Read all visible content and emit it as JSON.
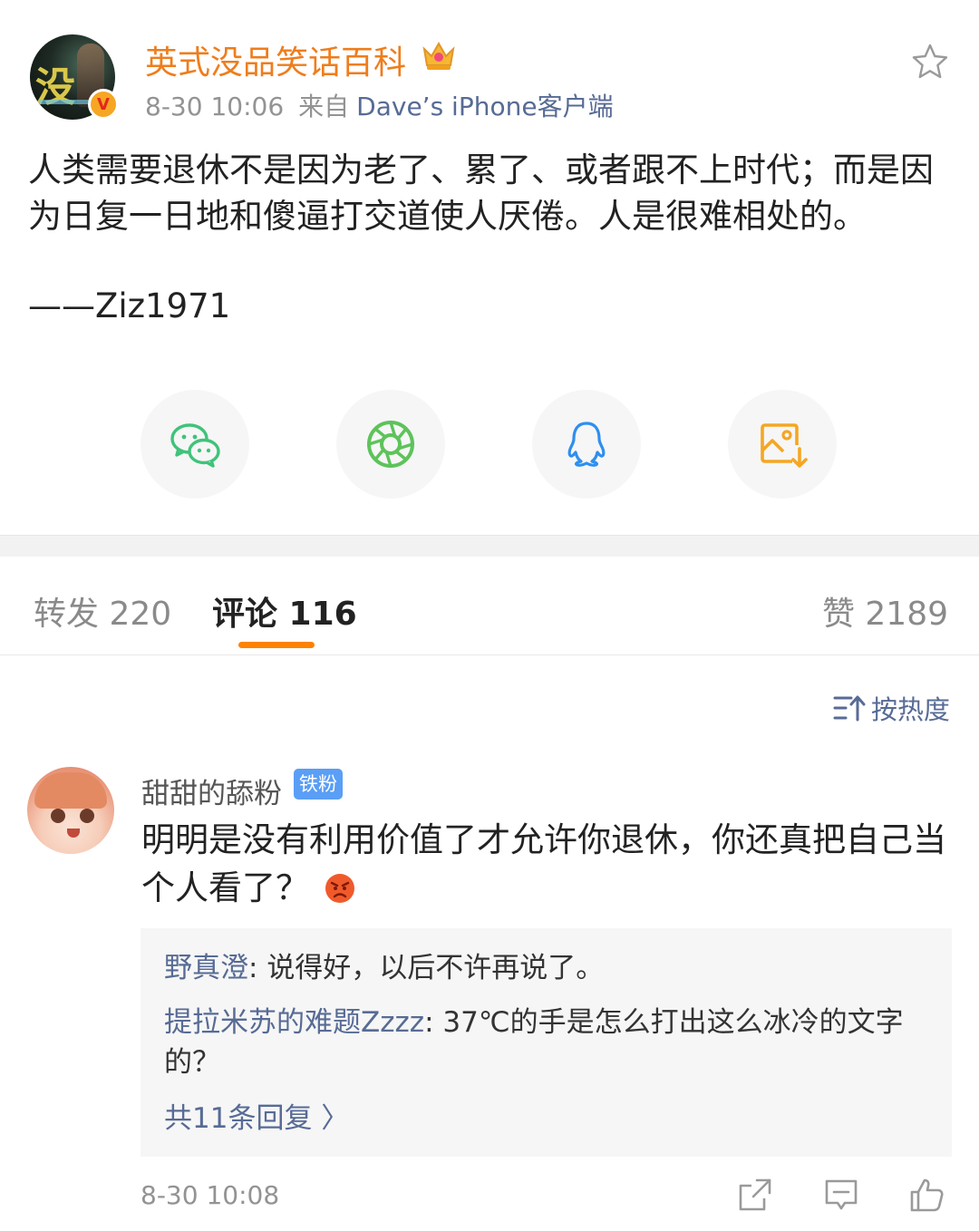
{
  "post": {
    "author": "英式没品笑话百科",
    "time": "8-30 10:06",
    "via_label": "来自",
    "source": "Dave’s iPhone客户端",
    "text": "人类需要退休不是因为老了、累了、或者跟不上时代；而是因为日复一日地和傻逼打交道使人厌倦。人是很难相处的。",
    "signature": "——Ziz1971",
    "icons": {
      "verified_badge": "verified-v-badge",
      "crown": "crown-icon",
      "favorite": "star-icon"
    }
  },
  "share_buttons": [
    "wechat-icon",
    "moments-icon",
    "qq-icon",
    "save-image-icon"
  ],
  "tabs": {
    "repost": "转发 220",
    "comments": "评论 116",
    "likes": "赞 2189"
  },
  "sort": {
    "label": "按热度",
    "icon": "sort-icon"
  },
  "comment": {
    "user": "甜甜的舔粉",
    "badge": "铁粉",
    "text": "明明是没有利用价值了才允许你退休，你还真把自己当个人看了？",
    "emoji": "angry-face",
    "replies": [
      {
        "user": "野真澄",
        "text": "说得好，以后不许再说了。"
      },
      {
        "user": "提拉米苏的难题Zzzz",
        "text": "37℃的手是怎么打出这么冰冷的文字的？"
      }
    ],
    "more_replies": "共11条回复 〉",
    "time": "8-30 10:08",
    "actions": [
      "share-icon",
      "reply-icon",
      "like-icon"
    ]
  },
  "colors": {
    "author": "#ef7d1c",
    "link": "#576b95",
    "accent": "#ff8200",
    "badge": "#5a9ef5"
  }
}
